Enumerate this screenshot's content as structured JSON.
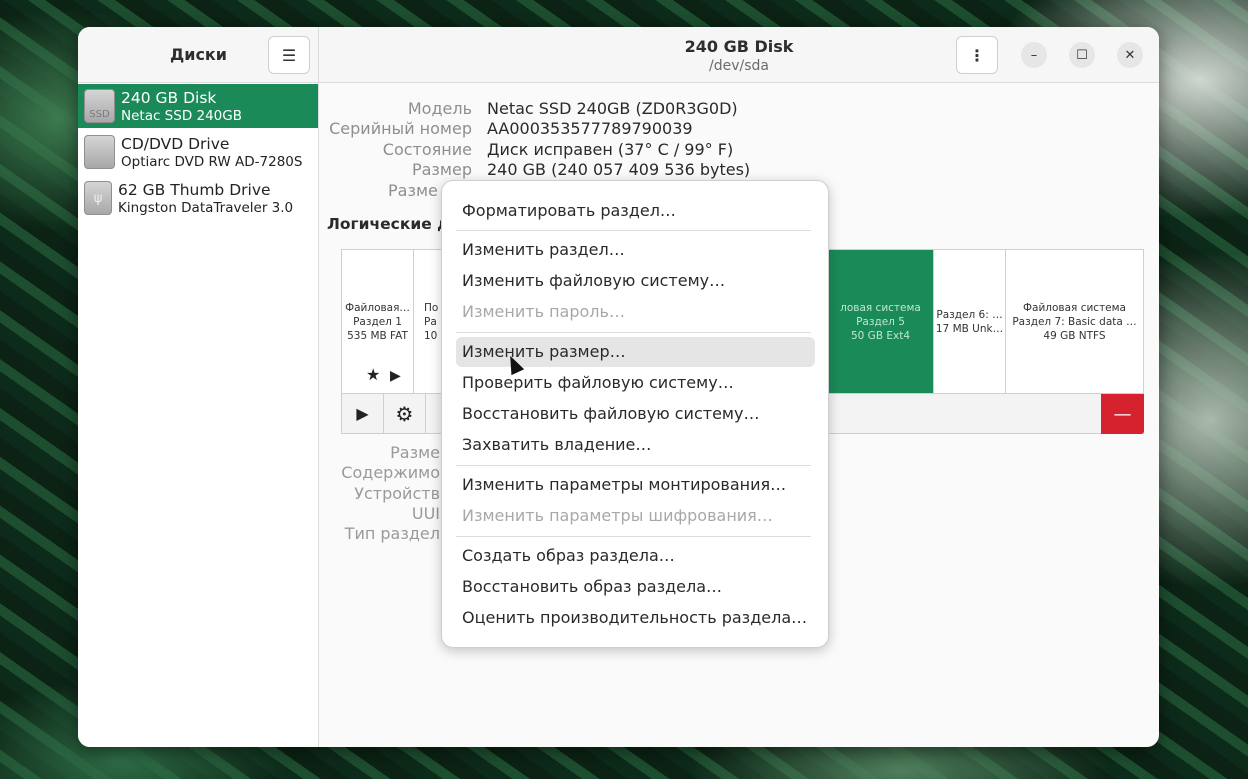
{
  "sidebar": {
    "title": "Диски",
    "disks": [
      {
        "name": "240 GB Disk",
        "sub": "Netac SSD 240GB",
        "icon_text": "SSD"
      },
      {
        "name": "CD/DVD Drive",
        "sub": "Optiarc DVD RW AD-7280S",
        "icon_text": ""
      },
      {
        "name": "62 GB Thumb Drive",
        "sub": "Kingston DataTraveler 3.0",
        "icon_text": ""
      }
    ]
  },
  "header": {
    "title": "240 GB Disk",
    "subtitle": "/dev/sda"
  },
  "disk_info": {
    "model_label": "Модель",
    "model_value": "Netac SSD 240GB (ZD0R3G0D)",
    "serial_label": "Серийный номер",
    "serial_value": "AA000353577789790039",
    "state_label": "Состояние",
    "state_value": "Диск исправен (37° C / 99° F)",
    "size_label": "Размер",
    "size_value": "240 GB (240 057 409 536 bytes)",
    "partitioning_label_partial": "Разме"
  },
  "volumes": {
    "title_partial": "Логические д",
    "partitions": [
      {
        "line1": "Файловая…",
        "line2": "Раздел 1",
        "line3": "535 MB FAT"
      },
      {
        "line1": "По",
        "line2": "Ра",
        "line3": "10"
      },
      {
        "line1": "ловая система",
        "line2": "Раздел 5",
        "line3": "50 GB Ext4"
      },
      {
        "line1": "Раздел 6: …",
        "line2": "17 MB Unk…",
        "line3": ""
      },
      {
        "line1": "Файловая система",
        "line2": "Раздел 7: Basic data …",
        "line3": "49 GB NTFS"
      }
    ],
    "details_partial": [
      "Разме",
      "Содержимо",
      "Устройств",
      "UUI",
      "Тип раздел"
    ]
  },
  "context_menu": {
    "items": [
      {
        "label": "Форматировать раздел…",
        "disabled": false
      },
      {
        "label": "Изменить раздел…",
        "disabled": false
      },
      {
        "label": "Изменить файловую систему…",
        "disabled": false
      },
      {
        "label": "Изменить пароль…",
        "disabled": true
      },
      {
        "label": "Изменить размер…",
        "disabled": false,
        "hover": true
      },
      {
        "label": "Проверить файловую систему…",
        "disabled": false
      },
      {
        "label": "Восстановить файловую систему…",
        "disabled": false
      },
      {
        "label": "Захватить владение…",
        "disabled": false
      },
      {
        "label": "Изменить параметры монтирования…",
        "disabled": false
      },
      {
        "label": "Изменить параметры шифрования…",
        "disabled": true
      },
      {
        "label": "Создать образ раздела…",
        "disabled": false
      },
      {
        "label": "Восстановить образ раздела…",
        "disabled": false
      },
      {
        "label": "Оценить производительность раздела…",
        "disabled": false
      }
    ]
  },
  "colors": {
    "accent": "#1b8a59",
    "danger": "#d6222f"
  },
  "icons": {
    "sidebar_menu": "hamburger-icon",
    "header_menu": "vertical-dots-icon",
    "minimize": "minimize-icon",
    "maximize": "maximize-icon",
    "close": "close-icon",
    "star": "star-icon",
    "play": "play-icon",
    "gear": "gear-icon",
    "delete": "minus-icon"
  }
}
